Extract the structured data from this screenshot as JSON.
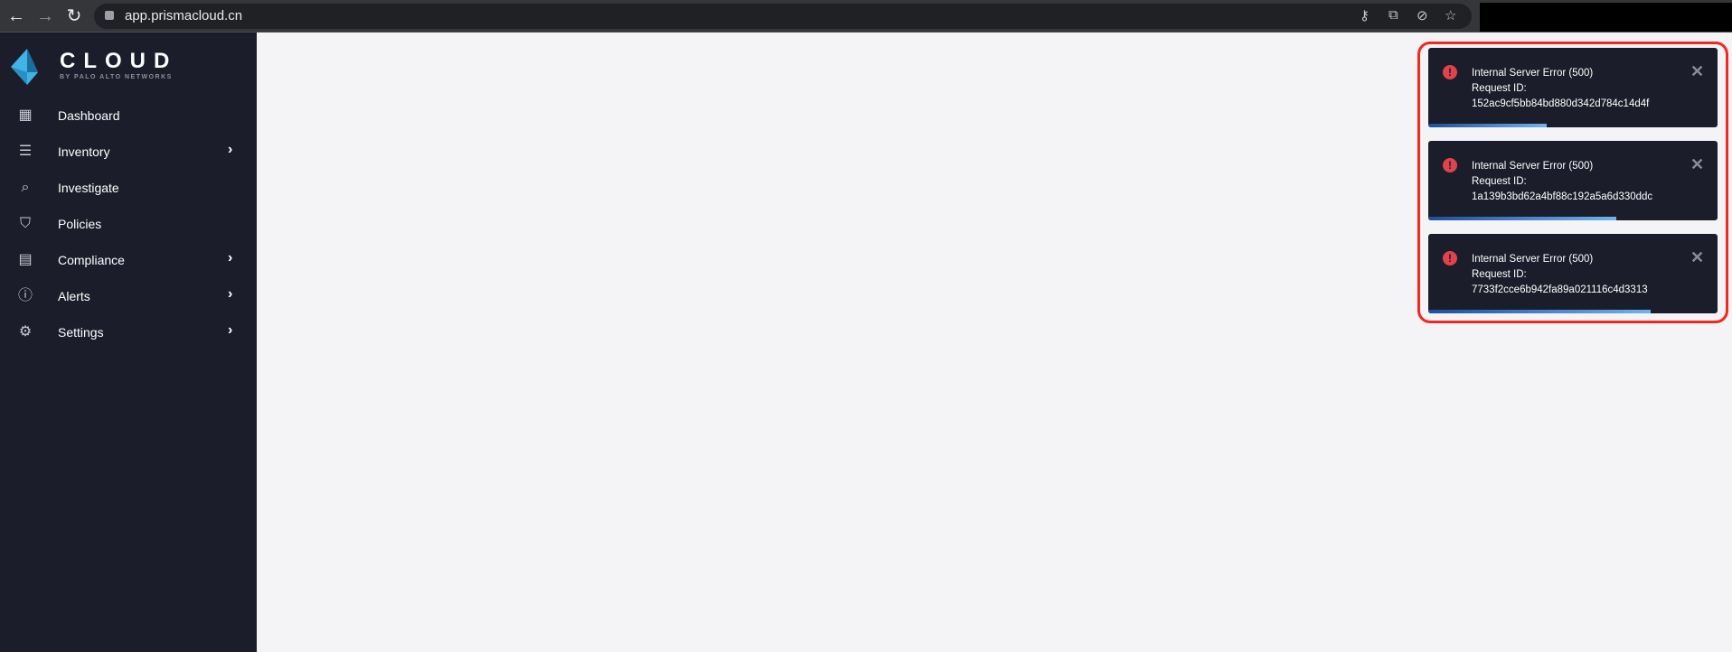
{
  "browser": {
    "url": "app.prismacloud.cn",
    "icons": [
      "back-icon",
      "forward-icon",
      "reload-icon",
      "lock-icon",
      "key-icon",
      "translate-icon",
      "eye-off-icon",
      "star-icon"
    ]
  },
  "brand": {
    "name": "CLOUD",
    "tagline": "BY PALO ALTO NETWORKS",
    "color": "#3fb4e5"
  },
  "sidebar": {
    "items": [
      {
        "label": "Dashboard",
        "icon": "dashboard-icon",
        "chevron": false
      },
      {
        "label": "Inventory",
        "icon": "inventory-list-icon",
        "chevron": true
      },
      {
        "label": "Investigate",
        "icon": "investigate-search-icon",
        "chevron": false
      },
      {
        "label": "Policies",
        "icon": "shield-check-icon",
        "chevron": false
      },
      {
        "label": "Compliance",
        "icon": "document-icon",
        "chevron": true
      },
      {
        "label": "Alerts",
        "icon": "alert-circle-icon",
        "chevron": true
      },
      {
        "label": "Settings",
        "icon": "gear-icon",
        "chevron": true
      }
    ]
  },
  "toasts": [
    {
      "title": "Internal Server Error (500)",
      "label": "Request ID:",
      "id": "152ac9cf5bb84bd880d342d784c14d4f",
      "progress": 0.41
    },
    {
      "title": "Internal Server Error (500)",
      "label": "Request ID:",
      "id": "1a139b3bd62a4bf88c192a5a6d330ddc",
      "progress": 0.65
    },
    {
      "title": "Internal Server Error (500)",
      "label": "Request ID:",
      "id": "7733f2cce6b942fa89a021116c4d3313",
      "progress": 0.77
    }
  ],
  "colors": {
    "error": "#e0434c",
    "highlight": "#f2281e",
    "sidebar": "#1b1e2a"
  }
}
